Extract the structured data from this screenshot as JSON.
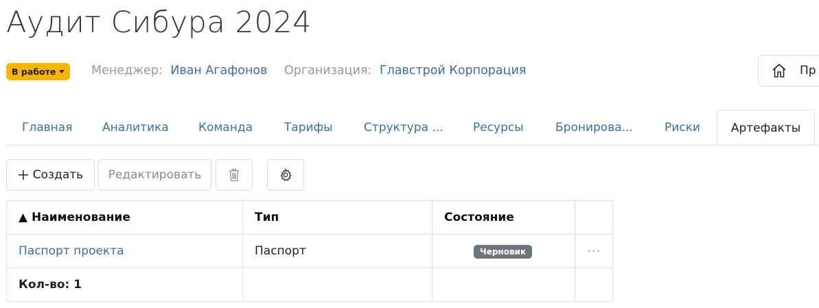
{
  "page": {
    "title": "Аудит Сибура 2024"
  },
  "header": {
    "status": "В работе",
    "manager_label": "Менеджер:",
    "manager_value": "Иван Агафонов",
    "org_label": "Организация:",
    "org_value": "Главстрой Корпорация",
    "home_text": "Пр"
  },
  "tabs": [
    {
      "label": "Главная"
    },
    {
      "label": "Аналитика"
    },
    {
      "label": "Команда"
    },
    {
      "label": "Тарифы"
    },
    {
      "label": "Структура ..."
    },
    {
      "label": "Ресурсы"
    },
    {
      "label": "Бронирова..."
    },
    {
      "label": "Риски"
    },
    {
      "label": "Артефакты",
      "active": true
    }
  ],
  "toolbar": {
    "create_label": "Создать",
    "edit_label": "Редактировать"
  },
  "table": {
    "sort_marker": "▲",
    "columns": [
      "Наименование",
      "Тип",
      "Состояние",
      ""
    ],
    "rows": [
      {
        "name": "Паспорт проекта",
        "type": "Паспорт",
        "state": "Черновик",
        "actions": "···"
      }
    ],
    "footer": {
      "count_label": "Кол-во: 1"
    }
  },
  "colors": {
    "status_badge": "#f7b500",
    "link": "#3a6ea5",
    "state_badge": "#6c757d"
  },
  "icons": [
    "home-icon",
    "plus-icon",
    "trash-icon",
    "gear-icon",
    "more-icon",
    "caret-down-icon"
  ]
}
